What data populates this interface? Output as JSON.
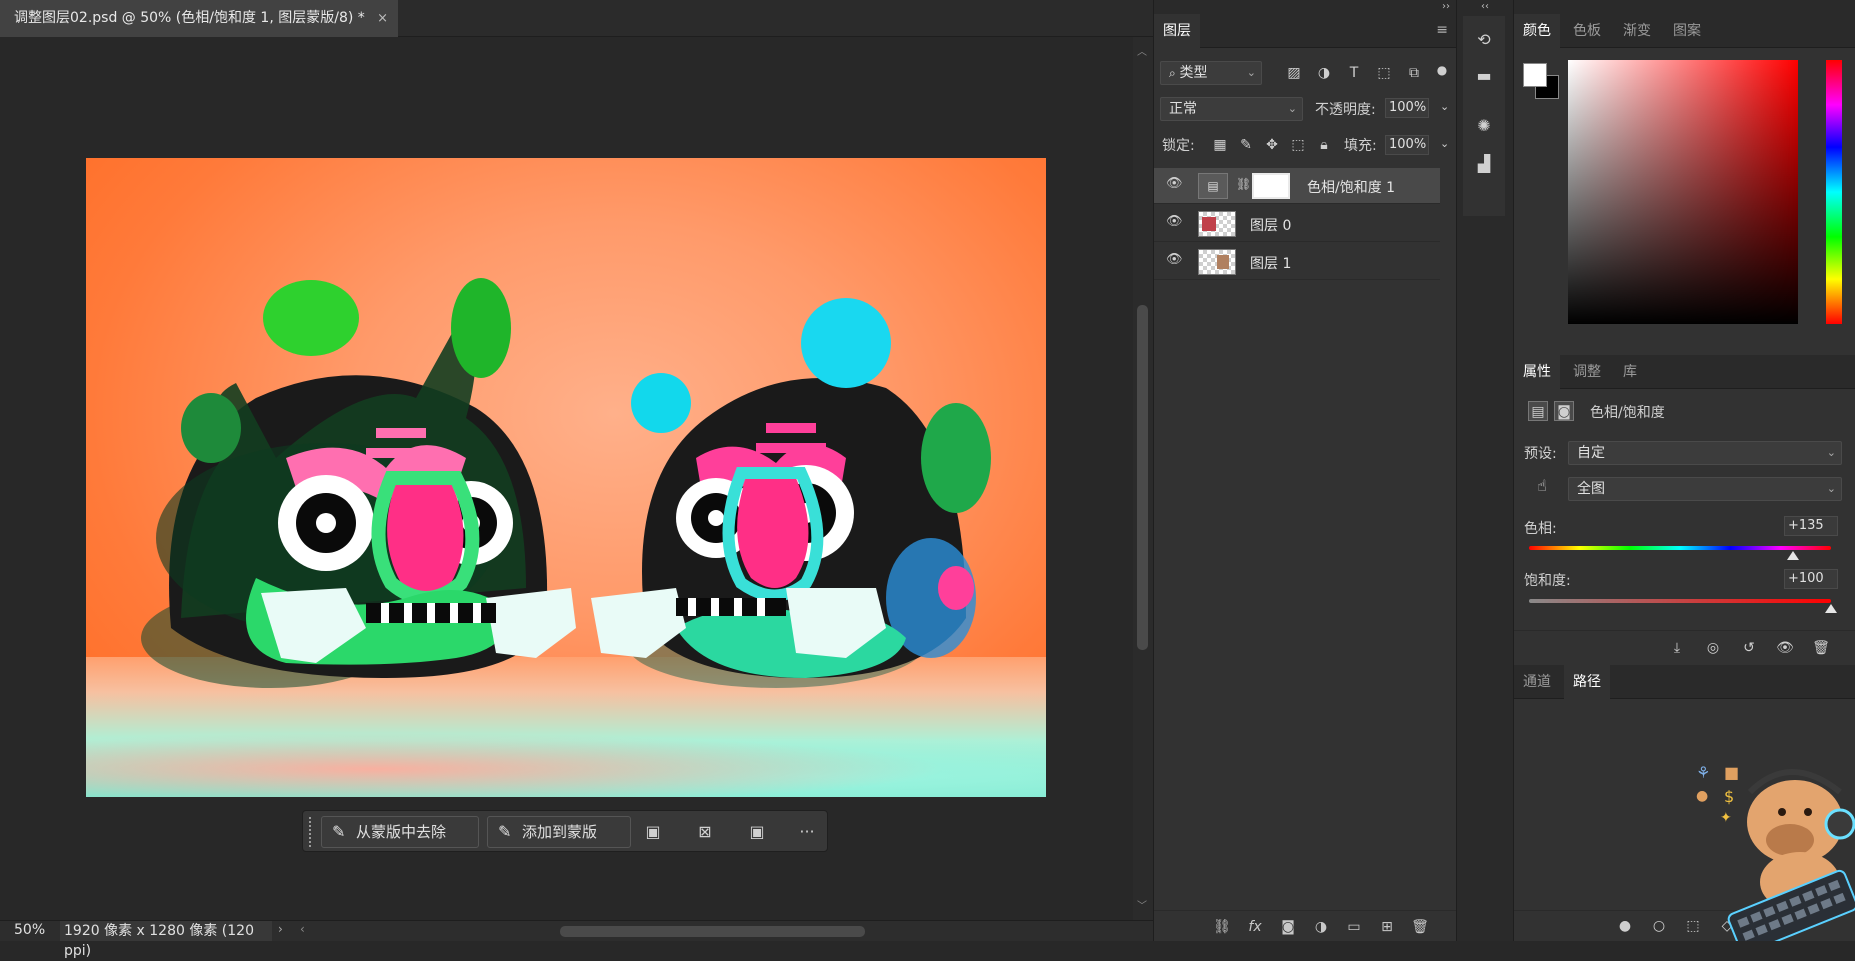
{
  "document": {
    "tab_title": "调整图层02.psd @ 50% (色相/饱和度 1, 图层蒙版/8) *",
    "close_glyph": "×"
  },
  "mask_toolbar": {
    "remove_label": "从蒙版中去除",
    "add_label": "添加到蒙版",
    "more_glyph": "···"
  },
  "statusbar": {
    "zoom": "50%",
    "dimensions": "1920 像素 x 1280 像素 (120 ppi)",
    "arrow": "›"
  },
  "layers_panel": {
    "tab_label": "图层",
    "filter_kind": "类型",
    "blend_mode": "正常",
    "opacity_label": "不透明度:",
    "opacity_value": "100%",
    "lock_label": "锁定:",
    "fill_label": "填充:",
    "fill_value": "100%",
    "layers": [
      {
        "name": "色相/饱和度 1",
        "type": "adjustment",
        "selected": true,
        "visible": true
      },
      {
        "name": "图层 0",
        "type": "pixel",
        "selected": false,
        "visible": true
      },
      {
        "name": "图层 1",
        "type": "pixel",
        "selected": false,
        "visible": true
      }
    ]
  },
  "color_panel": {
    "tabs": [
      "颜色",
      "色板",
      "渐变",
      "图案"
    ],
    "active_tab": "颜色",
    "foreground": "#ffffff",
    "background": "#000000",
    "picker_hue": "#ff0000"
  },
  "properties_panel": {
    "tabs": [
      "属性",
      "调整",
      "库"
    ],
    "active_tab": "属性",
    "title": "色相/饱和度",
    "preset_label": "预设:",
    "preset_value": "自定",
    "channel_value": "全图",
    "hue_label": "色相:",
    "hue_value": "+135",
    "saturation_label": "饱和度:",
    "saturation_value": "+100"
  },
  "paths_panel": {
    "tabs": [
      "通道",
      "路径"
    ],
    "active_tab": "路径"
  },
  "icons": {
    "eye": "eye-icon",
    "chain": "chain-link-icon",
    "menu": "panel-menu-icon"
  }
}
